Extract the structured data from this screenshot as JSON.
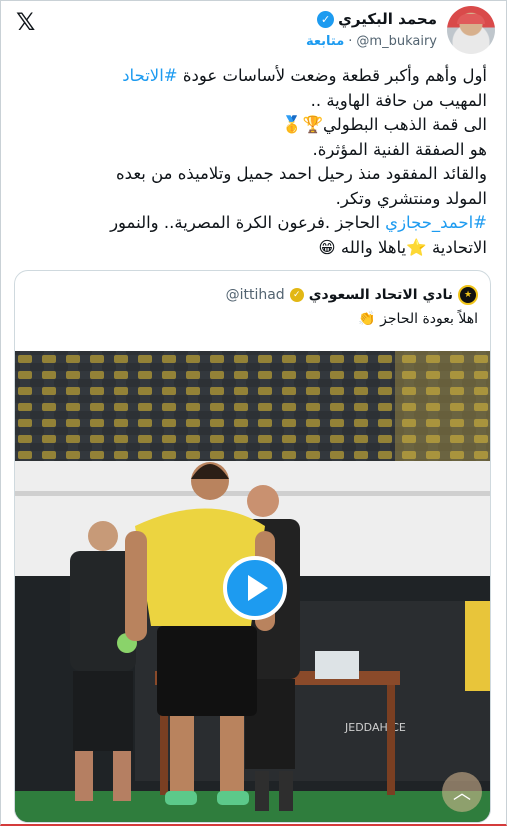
{
  "author": {
    "name": "محمد البكيري",
    "handle": "@m_bukairy",
    "separator": "·",
    "follow_label": "متابعة"
  },
  "icons": {
    "x_logo": "x-logo-icon",
    "verified": "verified-badge-icon",
    "play": "play-icon",
    "scroll": "chevron-up-icon"
  },
  "tweet": {
    "line1_a": "أول وأهم وأكبر قطعة وضعت لأساسات عودة ",
    "line1_tag": "#الاتحاد",
    "line2": "المهيب من حافة الهاوية ..",
    "line3": "الى قمة الذهب البطولي🏆🥇",
    "line4": "هو الصفقة الفنية المؤثرة.",
    "line5": "والقائد المفقود منذ رحيل احمد جميل وتلاميذه من بعده",
    "line6": "المولد ومنتشري وتكر.",
    "line7_tag": "#احمد_حجازي",
    "line7_b": " الحاجز .فرعون الكرة المصرية.. والنمور",
    "line8": "الاتحادية ⭐ياهلا والله 😁"
  },
  "quote": {
    "name": "نادي الاتحاد السعودي",
    "handle": "@ittihad",
    "text": "اهلاً بعودة الحاجز 👏"
  },
  "colors": {
    "accent": "#1d9bf0",
    "club_yellow": "#f0c419",
    "seat_yellow": "#e8c53a"
  }
}
